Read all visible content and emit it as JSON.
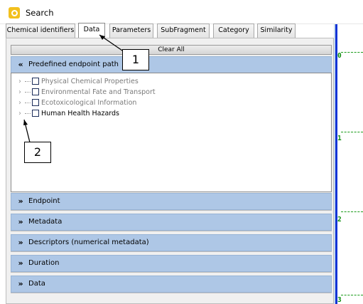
{
  "window": {
    "title": "Search"
  },
  "tabs": [
    {
      "label": "Chemical identifiers"
    },
    {
      "label": "Data"
    },
    {
      "label": "Parameters"
    },
    {
      "label": "SubFragment"
    },
    {
      "label": "Category"
    },
    {
      "label": "Similarity"
    }
  ],
  "active_tab": "Data",
  "toolbar": {
    "clear_all_label": "Clear All"
  },
  "predefined": {
    "header_label": "Predefined endpoint path",
    "expanded": true,
    "tree": [
      {
        "label": "Physical Chemical Properties",
        "checked": false,
        "enabled": false
      },
      {
        "label": "Environmental Fate and Transport",
        "checked": false,
        "enabled": false
      },
      {
        "label": "Ecotoxicological Information",
        "checked": false,
        "enabled": false
      },
      {
        "label": "Human Health Hazards",
        "checked": false,
        "enabled": true
      }
    ]
  },
  "sections": [
    {
      "label": "Endpoint",
      "expanded": false
    },
    {
      "label": "Metadata",
      "expanded": false
    },
    {
      "label": "Descriptors (numerical metadata)",
      "expanded": false
    },
    {
      "label": "Duration",
      "expanded": false
    },
    {
      "label": "Data",
      "expanded": false
    }
  ],
  "side_markers": [
    "0",
    "1",
    "2",
    "3"
  ],
  "callouts": [
    {
      "number": "1"
    },
    {
      "number": "2"
    }
  ],
  "colors": {
    "section_header": "#aec7e6",
    "side_line": "#1234d6",
    "side_marker": "#0a8a0a"
  }
}
